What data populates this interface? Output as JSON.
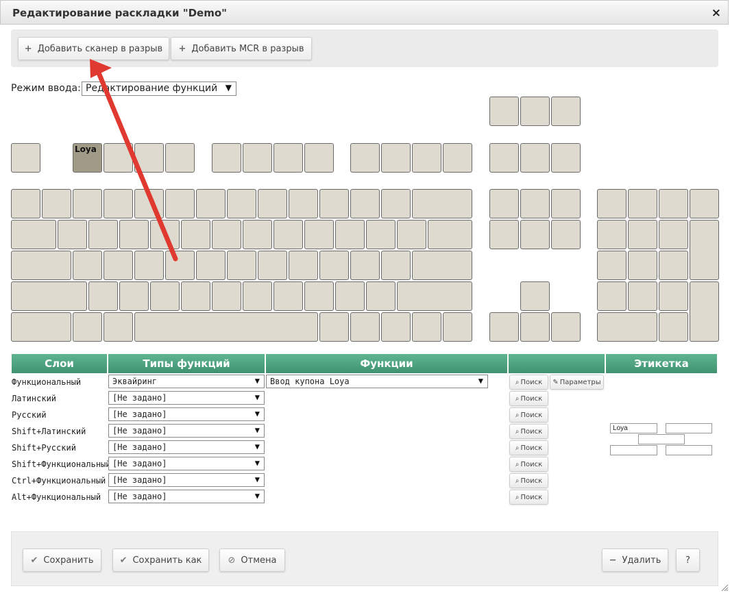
{
  "window": {
    "title": "Редактирование раскладки \"Demo\"",
    "close_glyph": "×"
  },
  "toolbar": {
    "add_scanner": "Добавить сканер в разрыв",
    "add_mcr": "Добавить MCR в разрыв"
  },
  "mode": {
    "label": "Режим ввода:",
    "value": "Редактирование функций"
  },
  "keyboard": {
    "active_key_label": "Loya",
    "active_color": "#a19a86",
    "key_color": "#dedad0"
  },
  "table": {
    "headers": {
      "layers": "Слои",
      "function_types": "Типы функций",
      "functions": "Функции",
      "actions": "",
      "label": "Этикетка"
    },
    "rows": [
      {
        "layer": "Функциональный",
        "type": "Эквайринг",
        "function": "Ввод купона Loya"
      },
      {
        "layer": "Латинский",
        "type": "[Не задано]"
      },
      {
        "layer": "Русский",
        "type": "[Не задано]"
      },
      {
        "layer": "Shift+Латинский",
        "type": "[Не задано]"
      },
      {
        "layer": "Shift+Русский",
        "type": "[Не задано]"
      },
      {
        "layer": "Shift+Функциональный",
        "type": "[Не задано]"
      },
      {
        "layer": "Ctrl+Функциональный",
        "type": "[Не задано]"
      },
      {
        "layer": "Alt+Функциональный",
        "type": "[Не задано]"
      }
    ],
    "search_label": "Поиск",
    "params_label": "Параметры",
    "label_fields": [
      "Loya",
      "",
      "",
      "",
      ""
    ]
  },
  "footer": {
    "save": "Сохранить",
    "save_as": "Сохранить как",
    "cancel": "Отмена",
    "delete": "Удалить",
    "help": "?"
  },
  "colors": {
    "header_green": "#4ea57f",
    "annotation_arrow": "#e0392f"
  }
}
